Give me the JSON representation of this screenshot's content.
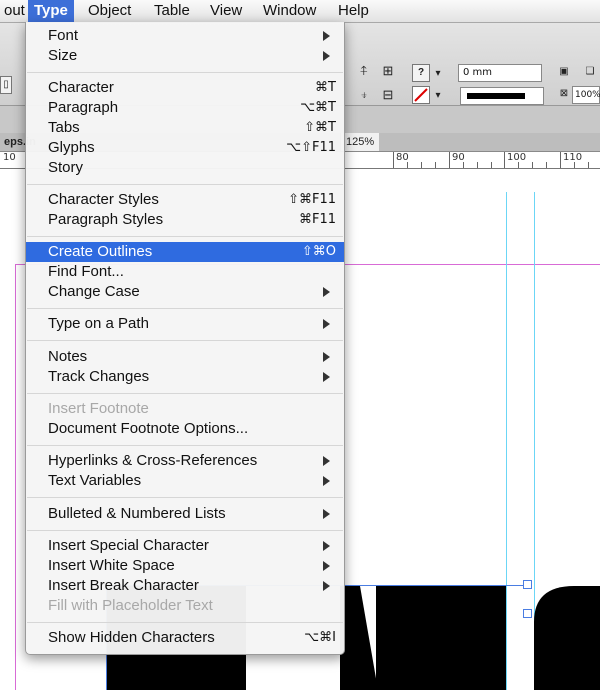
{
  "menubar": {
    "items": [
      "out",
      "Type",
      "Object",
      "Table",
      "View",
      "Window",
      "Help"
    ]
  },
  "control": {
    "stroke_weight": "0 mm",
    "zoom_field": "100%",
    "question_glyph": "?"
  },
  "tabs": {
    "doc_tab": "eps.in",
    "zoom": "125%"
  },
  "ruler": {
    "labels": [
      "10",
      "80",
      "90",
      "100",
      "110"
    ]
  },
  "type_menu": {
    "items": [
      {
        "label": "Font",
        "submenu": true
      },
      {
        "label": "Size",
        "submenu": true
      },
      {
        "label": "Character",
        "shortcut": "⌘T"
      },
      {
        "label": "Paragraph",
        "shortcut": "⌥⌘T"
      },
      {
        "label": "Tabs",
        "shortcut": "⇧⌘T"
      },
      {
        "label": "Glyphs",
        "shortcut": "⌥⇧F11"
      },
      {
        "label": "Story"
      },
      {
        "label": "Character Styles",
        "shortcut": "⇧⌘F11"
      },
      {
        "label": "Paragraph Styles",
        "shortcut": "⌘F11"
      },
      {
        "label": "Create Outlines",
        "shortcut": "⇧⌘O",
        "highlighted": true
      },
      {
        "label": "Find Font..."
      },
      {
        "label": "Change Case",
        "submenu": true
      },
      {
        "label": "Type on a Path",
        "submenu": true
      },
      {
        "label": "Notes",
        "submenu": true
      },
      {
        "label": "Track Changes",
        "submenu": true
      },
      {
        "label": "Insert Footnote",
        "disabled": true
      },
      {
        "label": "Document Footnote Options..."
      },
      {
        "label": "Hyperlinks & Cross-References",
        "submenu": true
      },
      {
        "label": "Text Variables",
        "submenu": true
      },
      {
        "label": "Bulleted & Numbered Lists",
        "submenu": true
      },
      {
        "label": "Insert Special Character",
        "submenu": true
      },
      {
        "label": "Insert White Space",
        "submenu": true
      },
      {
        "label": "Insert Break Character",
        "submenu": true
      },
      {
        "label": "Fill with Placeholder Text",
        "disabled": true
      },
      {
        "label": "Show Hidden Characters",
        "shortcut": "⌥⌘I"
      }
    ]
  },
  "colors": {
    "highlight": "#2f6be0",
    "guide": "#6bd6f6",
    "margin": "#d86bd6"
  }
}
